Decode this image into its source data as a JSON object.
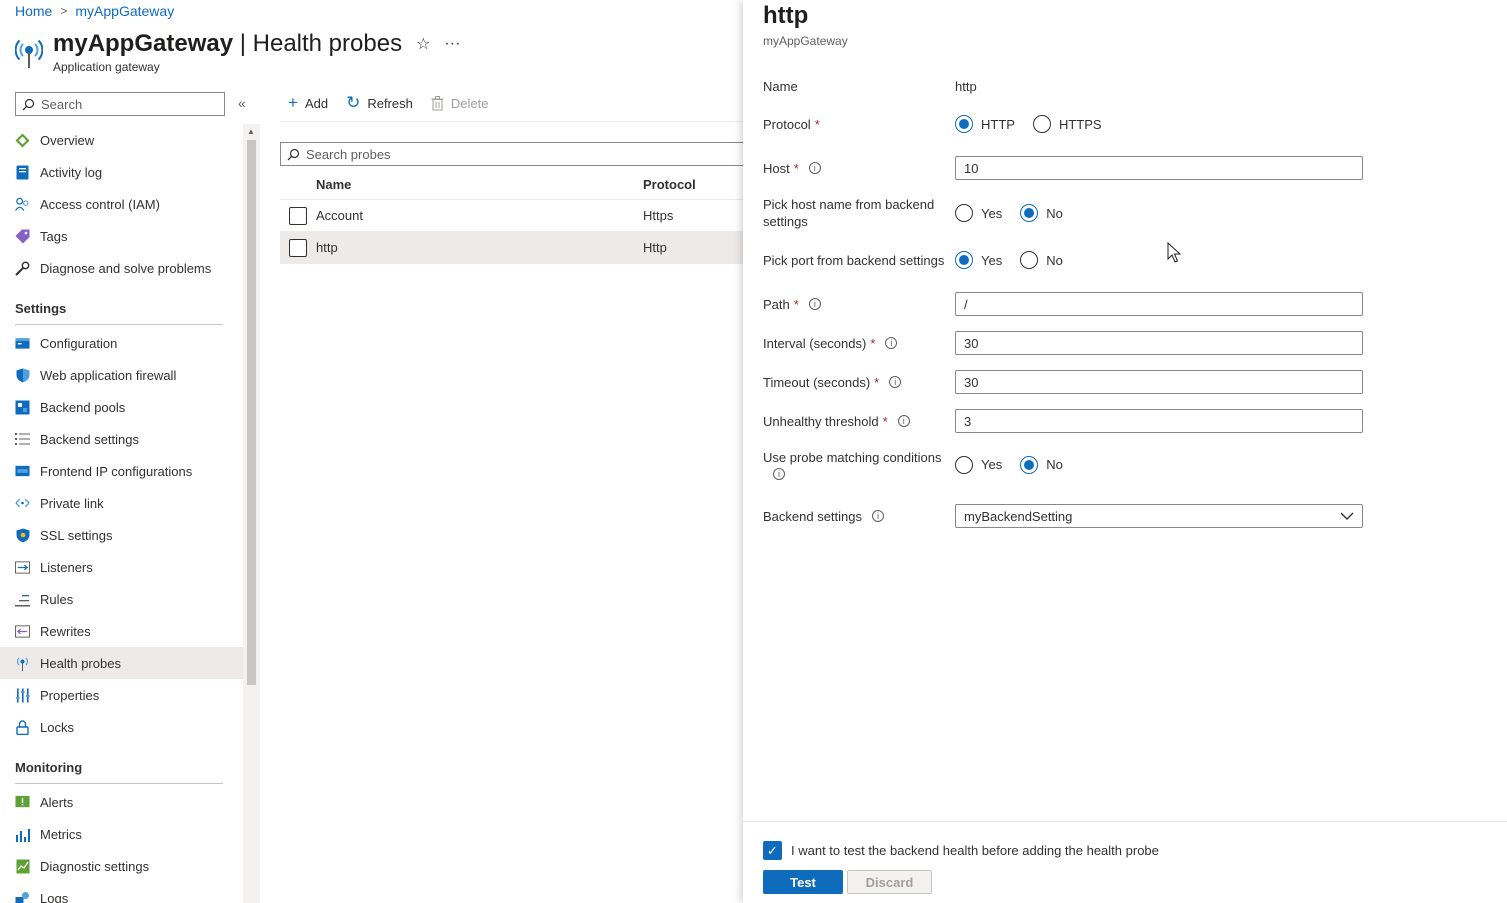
{
  "breadcrumb": {
    "home": "Home",
    "current": "myAppGateway"
  },
  "header": {
    "resource_name": "myAppGateway",
    "page_name": "Health probes",
    "title_separator": " | ",
    "subtitle": "Application gateway",
    "favorite_icon": "☆",
    "more_icon": "···"
  },
  "sidebar": {
    "search_placeholder": "Search",
    "collapse_icon": "«",
    "items_top": [
      {
        "label": "Overview",
        "icon": "overview-icon"
      },
      {
        "label": "Activity log",
        "icon": "activity-log-icon"
      },
      {
        "label": "Access control (IAM)",
        "icon": "iam-icon"
      },
      {
        "label": "Tags",
        "icon": "tag-icon"
      },
      {
        "label": "Diagnose and solve problems",
        "icon": "wrench-icon"
      }
    ],
    "section_settings": "Settings",
    "items_settings": [
      {
        "label": "Configuration",
        "icon": "configuration-icon"
      },
      {
        "label": "Web application firewall",
        "icon": "firewall-shield-icon"
      },
      {
        "label": "Backend pools",
        "icon": "backend-pools-icon"
      },
      {
        "label": "Backend settings",
        "icon": "list-settings-icon"
      },
      {
        "label": "Frontend IP configurations",
        "icon": "frontend-ip-icon"
      },
      {
        "label": "Private link",
        "icon": "private-link-icon"
      },
      {
        "label": "SSL settings",
        "icon": "ssl-shield-icon"
      },
      {
        "label": "Listeners",
        "icon": "listeners-icon"
      },
      {
        "label": "Rules",
        "icon": "rules-icon"
      },
      {
        "label": "Rewrites",
        "icon": "rewrites-icon"
      },
      {
        "label": "Health probes",
        "icon": "health-probe-icon",
        "active": true
      },
      {
        "label": "Properties",
        "icon": "properties-icon"
      },
      {
        "label": "Locks",
        "icon": "lock-icon"
      }
    ],
    "section_monitoring": "Monitoring",
    "items_monitoring": [
      {
        "label": "Alerts",
        "icon": "alerts-icon"
      },
      {
        "label": "Metrics",
        "icon": "metrics-icon"
      },
      {
        "label": "Diagnostic settings",
        "icon": "diagnostic-settings-icon"
      },
      {
        "label": "Logs",
        "icon": "logs-icon"
      }
    ]
  },
  "toolbar": {
    "add": "Add",
    "refresh": "Refresh",
    "delete": "Delete"
  },
  "probes": {
    "search_placeholder": "Search probes",
    "columns": [
      "Name",
      "Protocol"
    ],
    "rows": [
      {
        "name": "Account",
        "protocol": "Https"
      },
      {
        "name": "http",
        "protocol": "Http"
      }
    ]
  },
  "blade": {
    "title": "http",
    "subtitle": "myAppGateway",
    "name_label": "Name",
    "name_value": "http",
    "protocol_label": "Protocol",
    "protocol_options": [
      "HTTP",
      "HTTPS"
    ],
    "protocol_selected": "HTTP",
    "host_label": "Host",
    "host_value": "10",
    "pick_host_label": "Pick host name from backend settings",
    "pick_host_selected": "No",
    "pick_port_label": "Pick port from backend settings",
    "pick_port_selected": "Yes",
    "yes": "Yes",
    "no": "No",
    "path_label": "Path",
    "path_value": "/",
    "interval_label": "Interval (seconds)",
    "interval_value": "30",
    "timeout_label": "Timeout (seconds)",
    "timeout_value": "30",
    "unhealthy_label": "Unhealthy threshold",
    "unhealthy_value": "3",
    "matching_label": "Use probe matching conditions",
    "matching_selected": "No",
    "backend_settings_label": "Backend settings",
    "backend_settings_value": "myBackendSetting",
    "required_mark": "*",
    "info_icon": "i",
    "test_consent": "I want to test the backend health before adding the health probe",
    "test_consent_checked": true,
    "test_button": "Test",
    "discard_button": "Discard"
  },
  "colors": {
    "accent": "#0f6cbd",
    "required": "#a4262c",
    "selected_row": "#edebe9"
  }
}
